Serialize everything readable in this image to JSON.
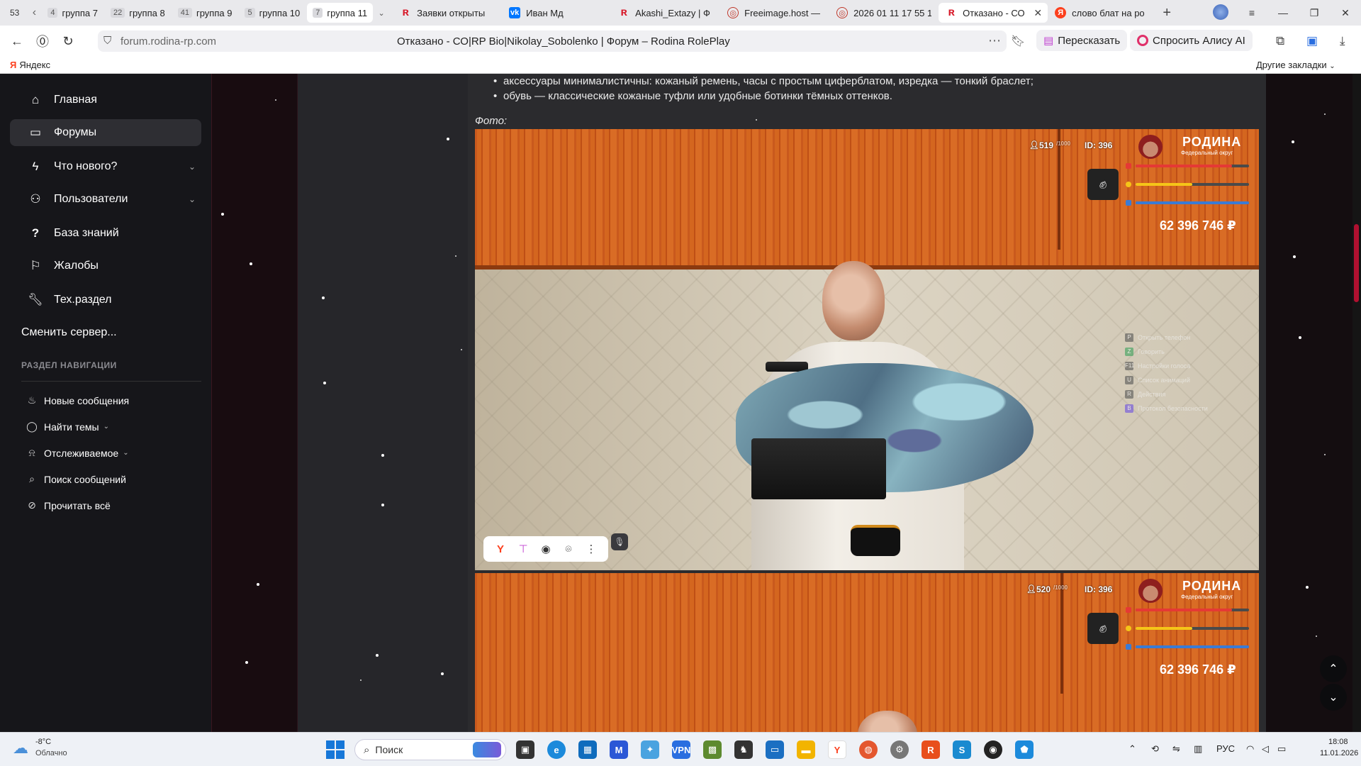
{
  "tabbar": {
    "tab_count": "53",
    "groups": [
      {
        "num": "4",
        "label": "группа 7"
      },
      {
        "num": "22",
        "label": "группа 8"
      },
      {
        "num": "41",
        "label": "группа 9"
      },
      {
        "num": "5",
        "label": "группа 10"
      },
      {
        "num": "7",
        "label": "группа 11"
      }
    ],
    "tabs": [
      {
        "label": "Заявки открыты",
        "favicon": "rodina-logo-icon",
        "color": "#d81b2b"
      },
      {
        "label": "Иван Мд",
        "favicon": "vk-icon",
        "color": "#0077ff"
      },
      {
        "label": "Akashi_Extazy | Ф",
        "favicon": "rodina-logo-icon",
        "color": "#d81b2b"
      },
      {
        "label": "Freeimage.host —",
        "favicon": "freeimage-icon",
        "color": "#c0392b"
      },
      {
        "label": "2026 01 11 17 55 1",
        "favicon": "freeimage-icon",
        "color": "#c0392b"
      },
      {
        "label": "Отказано - СО",
        "favicon": "rodina-logo-icon",
        "color": "#d81b2b",
        "active": true
      },
      {
        "label": "слово блат на ро",
        "favicon": "yandex-icon",
        "color": "#fc3f1d"
      }
    ]
  },
  "navbar": {
    "url": "forum.rodina-rp.com",
    "title": "Отказано - СО|RP Bio|Nikolay_Sobolenko | Форум – Rodina RolePlay",
    "retell_label": "Пересказать",
    "alice_label": "Спросить Алису AI"
  },
  "bookmarks": {
    "yandex": "Яндекс",
    "other": "Другие закладки"
  },
  "sidebar": {
    "items": [
      {
        "label": "Главная",
        "icon": "home-icon"
      },
      {
        "label": "Форумы",
        "icon": "forums-icon",
        "active": true
      },
      {
        "label": "Что нового?",
        "icon": "bolt-icon",
        "dropdown": true
      },
      {
        "label": "Пользователи",
        "icon": "users-icon",
        "dropdown": true
      },
      {
        "label": "База знаний",
        "icon": "question-icon"
      },
      {
        "label": "Жалобы",
        "icon": "flag-icon"
      },
      {
        "label": "Тех.раздел",
        "icon": "wrench-icon"
      }
    ],
    "switch_server": "Сменить сервер...",
    "nav_heading": "РАЗДЕЛ НАВИГАЦИИ",
    "subitems": [
      {
        "label": "Новые сообщения",
        "icon": "fire-icon"
      },
      {
        "label": "Найти темы",
        "icon": "chat-icon",
        "dropdown": true
      },
      {
        "label": "Отслеживаемое",
        "icon": "bell-icon",
        "dropdown": true
      },
      {
        "label": "Поиск сообщений",
        "icon": "search-icon"
      },
      {
        "label": "Прочитать всё",
        "icon": "eye-off-icon"
      }
    ]
  },
  "article": {
    "bullets": [
      "аксессуары минималистичны: кожаный ремень, часы с простым циферблатом, изредка — тонкий браслет;",
      "обувь — классические кожаные туфли или удобные ботинки тёмных оттенков."
    ],
    "photo_label": "Фото:"
  },
  "screenshots": [
    {
      "players": "519",
      "players_max": "/1000",
      "id": "ID: 396",
      "logo": "РОДИНА",
      "district": "Федеральный округ",
      "money": "62 396 746 ₽",
      "health": 0.85,
      "hunger": 0.5,
      "armor": 1.0,
      "menu": [
        {
          "key": "P",
          "label": "Открыть телефон"
        },
        {
          "key": "Z",
          "label": "Говорить"
        },
        {
          "key": "F11",
          "label": "Настройки голоса"
        },
        {
          "key": "U",
          "label": "Список анимаций"
        },
        {
          "key": "R",
          "label": "Действия"
        },
        {
          "key": "B",
          "label": "Протокол безопасности"
        }
      ]
    },
    {
      "players": "520",
      "players_max": "/1000",
      "id": "ID: 396",
      "logo": "РОДИНА",
      "district": "Федеральный округ",
      "money": "62 396 746 ₽",
      "health": 0.85,
      "hunger": 0.5,
      "armor": 1.0
    }
  ],
  "taskbar": {
    "temp": "-8°C",
    "weather": "Облачно",
    "search": "Поиск",
    "lang": "РУС",
    "time": "18:08",
    "date": "11.01.2026"
  },
  "colors": {
    "accent": "#b01030",
    "health": "#e53935",
    "hunger": "#f5c518",
    "armor": "#3b7bd4"
  }
}
